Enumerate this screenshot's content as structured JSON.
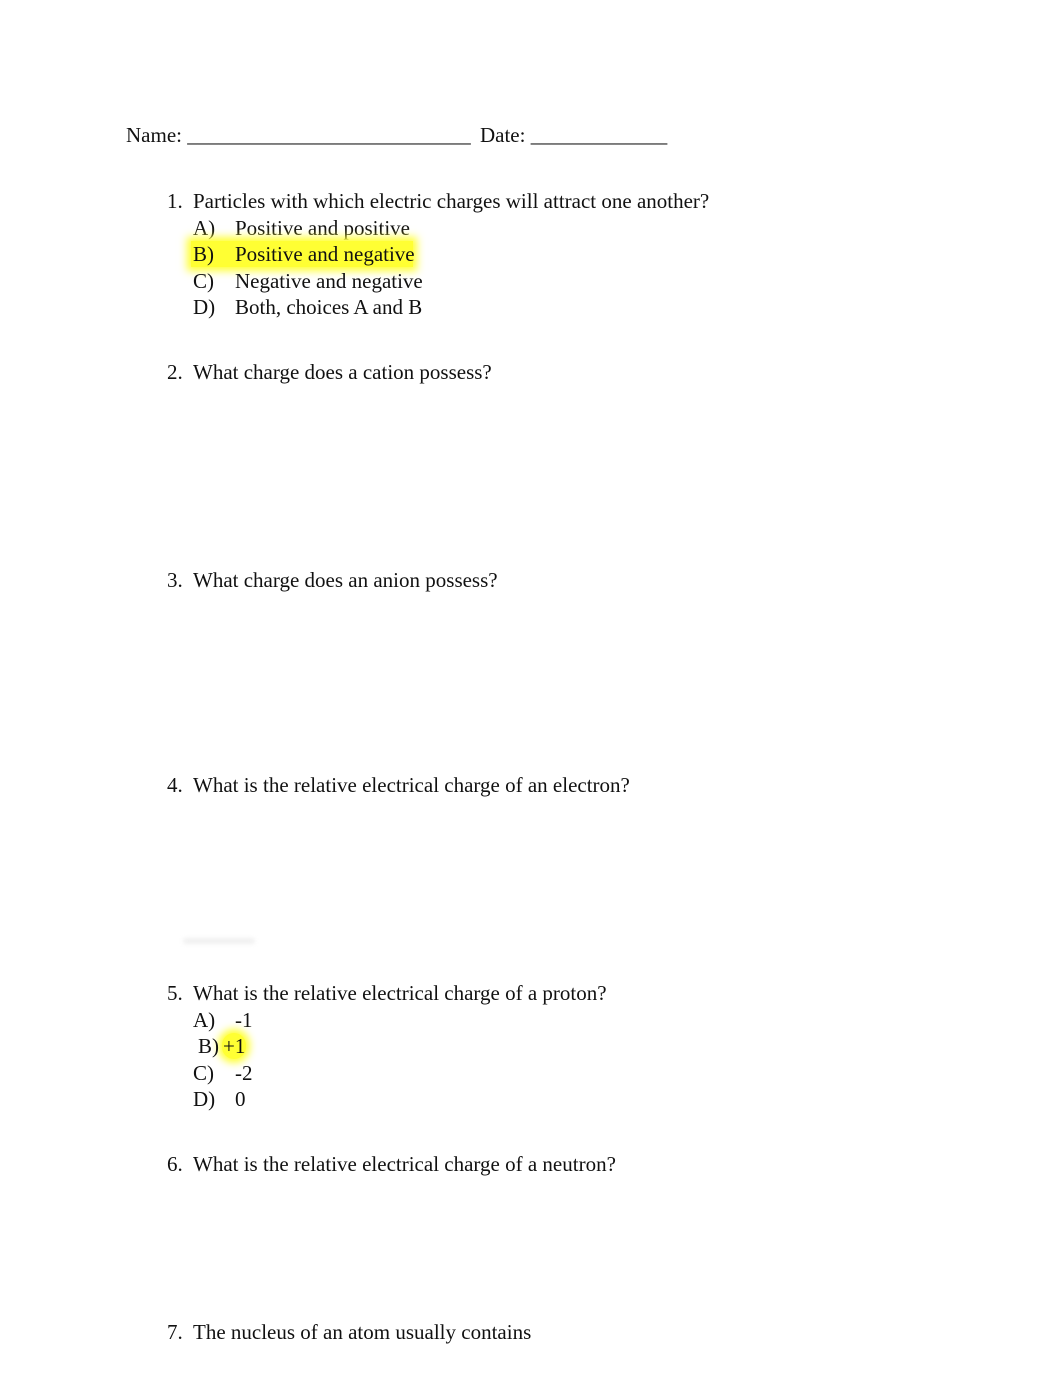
{
  "header": {
    "name_label": "Name:",
    "name_blank": "___________________________",
    "date_label": "Date:",
    "date_blank": "_____________"
  },
  "questions": [
    {
      "number": "1.",
      "text": "Particles with which electric charges will attract one another?",
      "options": [
        {
          "letter": "A)",
          "text": "Positive and positive",
          "highlighted": false
        },
        {
          "letter": "B)",
          "text": "Positive and negative",
          "highlighted": true
        },
        {
          "letter": "C)",
          "text": "Negative and negative",
          "highlighted": false
        },
        {
          "letter": "D)",
          "text": "Both, choices A and B",
          "highlighted": false
        }
      ]
    },
    {
      "number": "2.",
      "text": "What charge does a cation possess?"
    },
    {
      "number": "3.",
      "text": "What charge does an anion possess?"
    },
    {
      "number": "4.",
      "text": "What is the relative electrical charge of an electron?"
    },
    {
      "number": "5.",
      "text": "What is the relative electrical charge of a proton?",
      "options": [
        {
          "letter": "A)",
          "text": "-1",
          "highlighted": false
        },
        {
          "letter": "B)",
          "text": "+1",
          "highlighted": true
        },
        {
          "letter": "C)",
          "text": "-2",
          "highlighted": false
        },
        {
          "letter": "D)",
          "text": "0",
          "highlighted": false
        }
      ]
    },
    {
      "number": "6.",
      "text": "What is the relative electrical charge of a neutron?"
    },
    {
      "number": "7.",
      "text": "The nucleus of an atom usually contains"
    }
  ],
  "highlight_color": "#ffff33"
}
